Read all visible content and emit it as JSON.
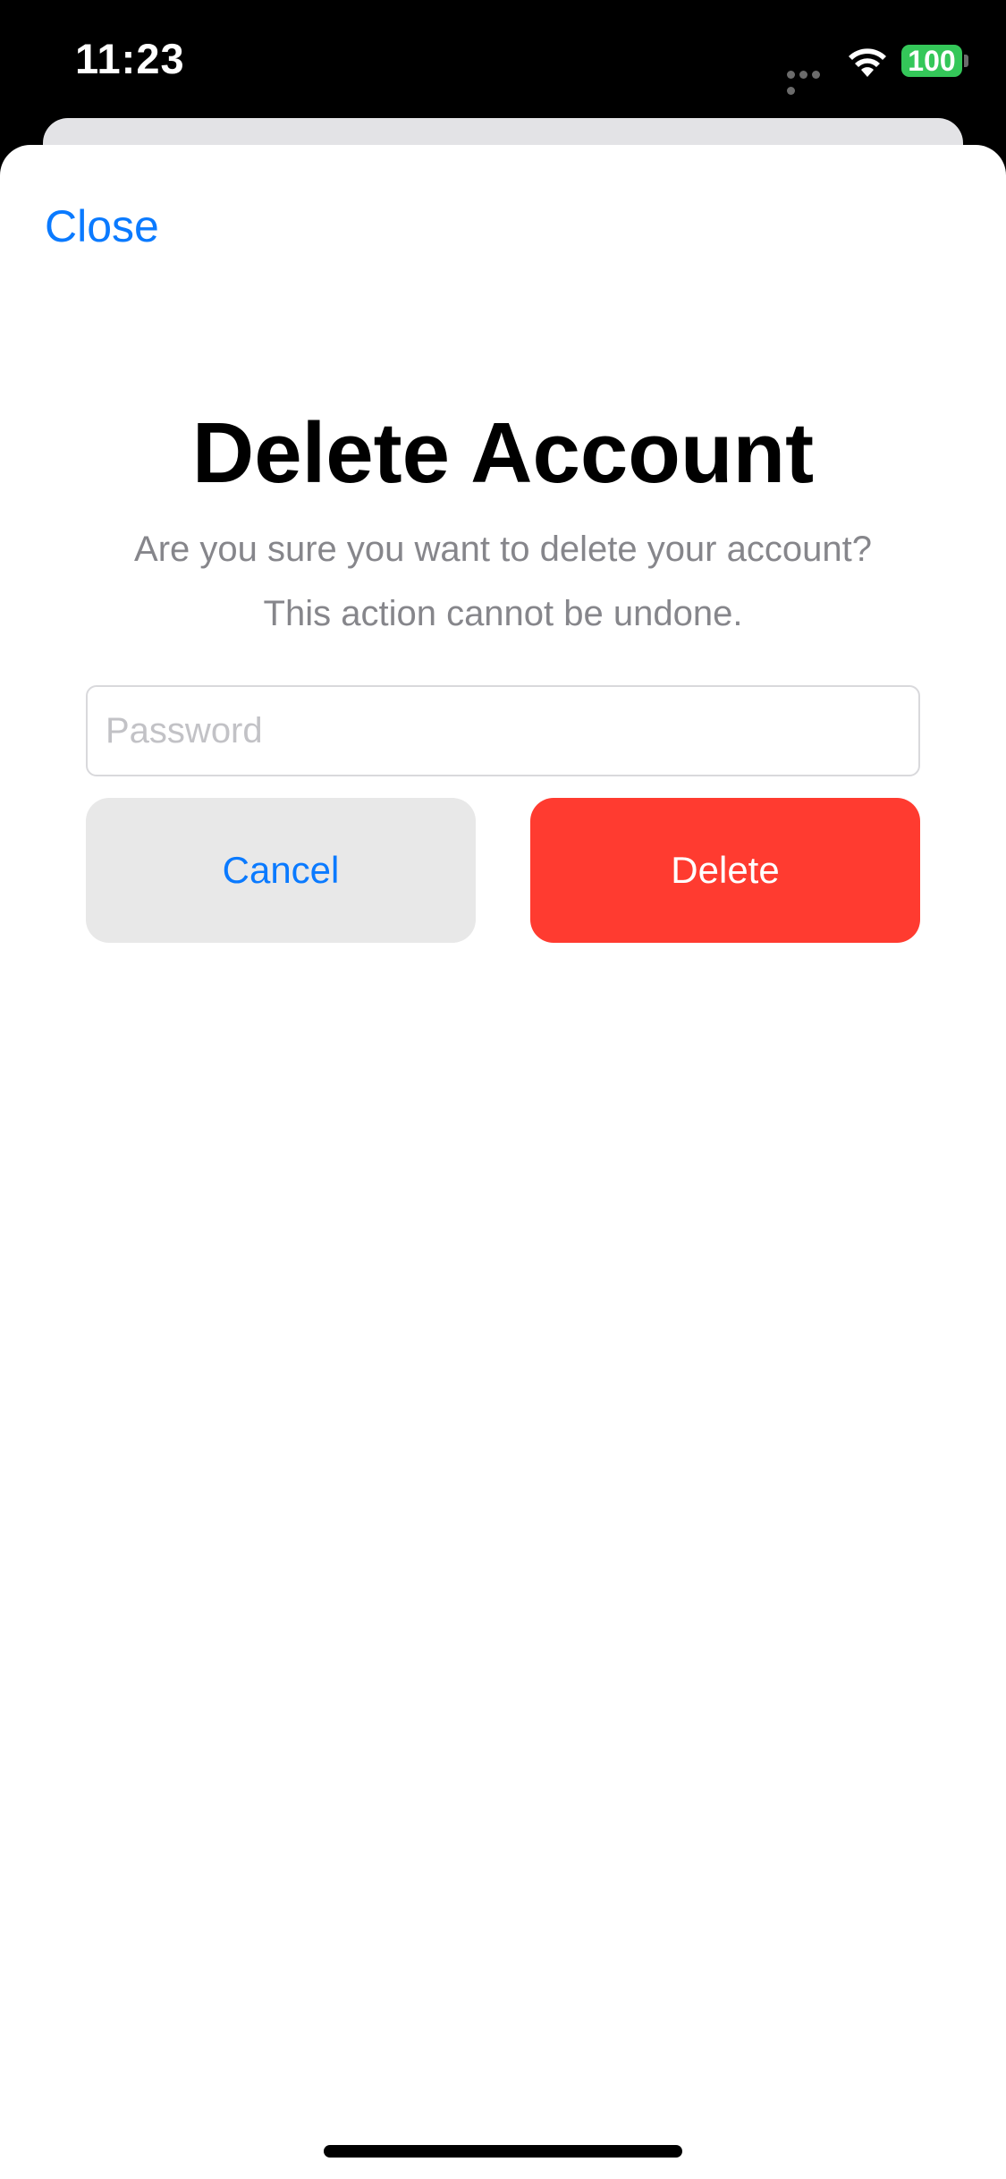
{
  "status_bar": {
    "time": "11:23",
    "battery": "100",
    "icons": [
      "cellular-signal-icon",
      "wifi-icon",
      "battery-icon"
    ]
  },
  "sheet": {
    "close_label": "Close",
    "title": "Delete Account",
    "message_line1": "Are you sure you want to delete your account?",
    "message_line2": "This action cannot be undone.",
    "password": {
      "placeholder": "Password",
      "value": ""
    },
    "cancel_label": "Cancel",
    "delete_label": "Delete"
  },
  "colors": {
    "accent": "#0a7aff",
    "destructive": "#ff3b30",
    "battery": "#34c759",
    "secondary_text": "#86868b"
  }
}
